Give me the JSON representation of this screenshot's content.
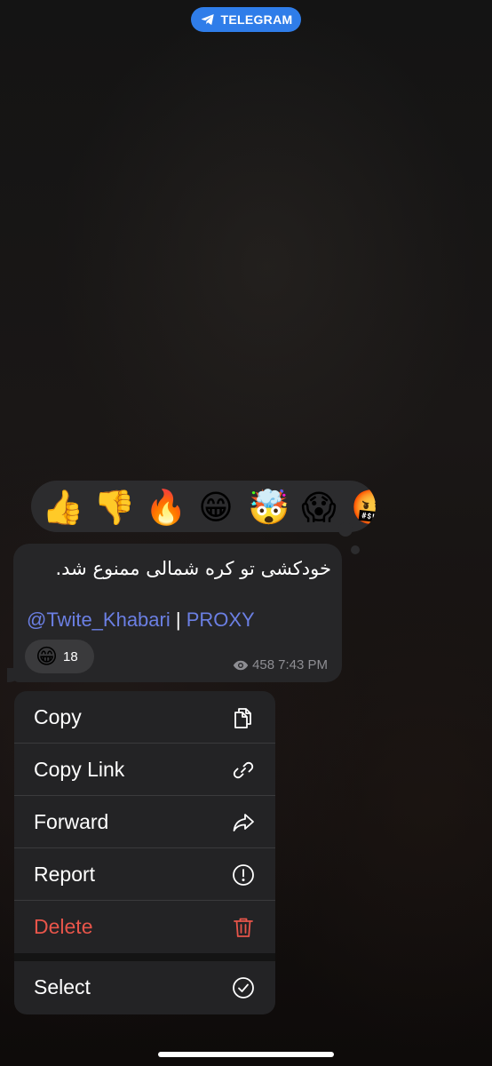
{
  "header": {
    "brand_label": "TELEGRAM"
  },
  "reactions_bar": {
    "emojis": [
      "👍",
      "👎",
      "🔥",
      "😁",
      "🤯",
      "😱",
      "🤬"
    ]
  },
  "message": {
    "text": "خودکشی تو کره شمالی ممنوع شد.",
    "channel_link": "@Twite_Khabari",
    "separator": " | ",
    "proxy_link": "PROXY",
    "reaction": {
      "emoji": "😁",
      "count": "18"
    },
    "views": "458",
    "time": "7:43 PM"
  },
  "context_menu": {
    "items": [
      {
        "label": "Copy",
        "icon": "copy-icon"
      },
      {
        "label": "Copy Link",
        "icon": "link-icon"
      },
      {
        "label": "Forward",
        "icon": "forward-icon"
      },
      {
        "label": "Report",
        "icon": "report-icon"
      },
      {
        "label": "Delete",
        "icon": "trash-icon"
      },
      {
        "label": "Select",
        "icon": "checkmark-circle-icon"
      }
    ]
  },
  "colors": {
    "accent": "#2f7de9",
    "link": "#6b7fe3",
    "danger": "#e8554a",
    "bubble": "#262628",
    "menu": "#232325"
  }
}
